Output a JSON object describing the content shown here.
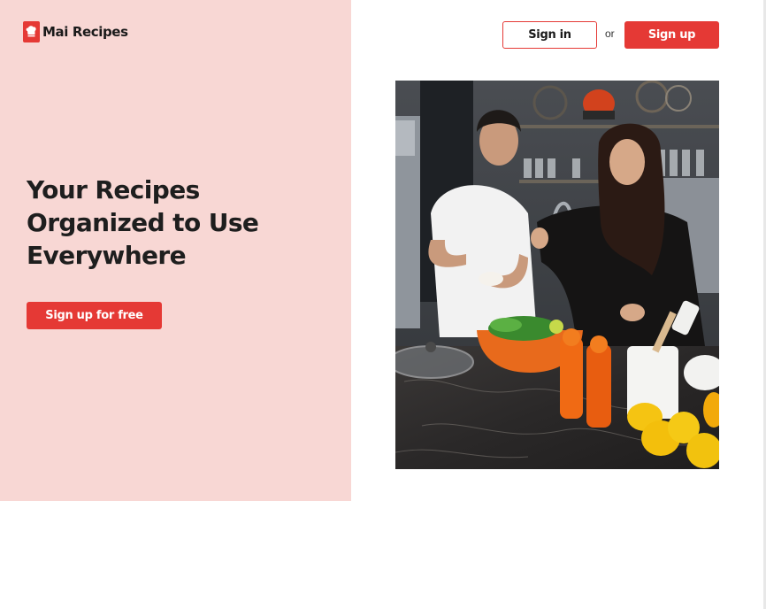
{
  "brand": {
    "name": "Mai Recipes",
    "accent_color": "#e53935",
    "panel_color": "#f8d7d4",
    "icon": "chef-hat-book-icon"
  },
  "header": {
    "signin_label": "Sign in",
    "or_label": "or",
    "signup_label": "Sign up"
  },
  "hero": {
    "title_lines": [
      "Your Recipes",
      "Organized to Use",
      "Everywhere"
    ],
    "cta_label": "Sign up for free",
    "image_description": "kitchen-couple-cooking-photo"
  }
}
